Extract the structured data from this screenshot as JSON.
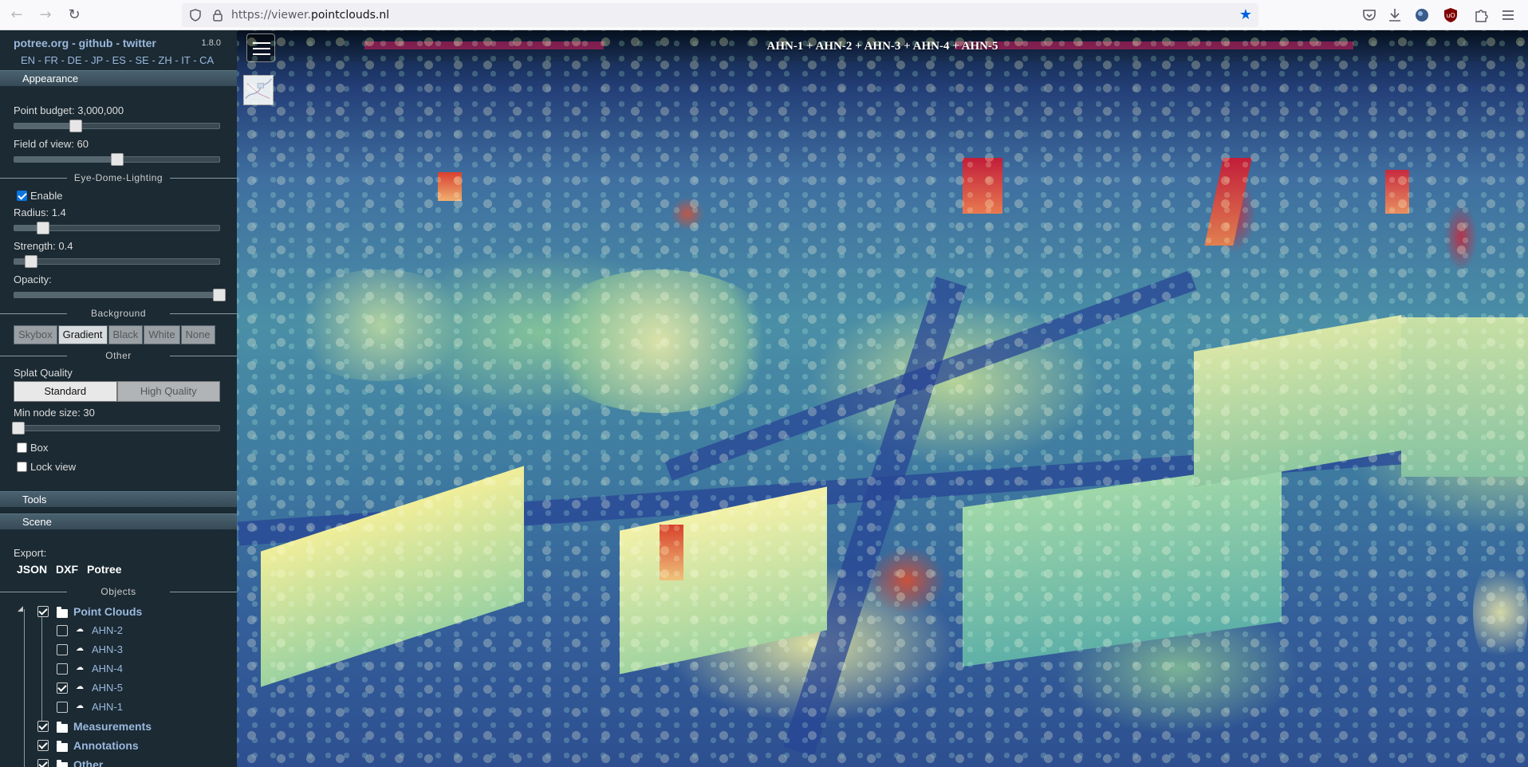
{
  "browser": {
    "url_prefix": "https://viewer.",
    "url_host": "pointclouds.nl"
  },
  "sidebar": {
    "brand": "potree.org - github - twitter",
    "version": "1.8.0",
    "languages": "EN - FR - DE - JP - ES - SE - ZH - IT - CA",
    "appearance": {
      "header": "Appearance",
      "point_budget_label": "Point budget: 3,000,000",
      "point_budget_fraction": 0.3,
      "fov_label": "Field of view: 60",
      "fov_fraction": 0.5,
      "edl_title": "Eye-Dome-Lighting",
      "edl_enable_label": "Enable",
      "edl_enabled": true,
      "radius_label": "Radius: 1.4",
      "radius_fraction": 0.14,
      "strength_label": "Strength: 0.4",
      "strength_fraction": 0.08,
      "opacity_label": "Opacity:",
      "opacity_fraction": 1.0,
      "background_title": "Background",
      "background_options": [
        "Skybox",
        "Gradient",
        "Black",
        "White",
        "None"
      ],
      "background_selected": "Gradient",
      "other_title": "Other",
      "splat_quality_label": "Splat Quality",
      "splat_options": [
        "Standard",
        "High Quality"
      ],
      "splat_selected": "Standard",
      "min_node_label": "Min node size: 30",
      "min_node_fraction": 0.02,
      "box_label": "Box",
      "lock_view_label": "Lock view"
    },
    "tools_header": "Tools",
    "scene_header": "Scene",
    "export_label": "Export:",
    "export_links": [
      "JSON",
      "DXF",
      "Potree"
    ],
    "objects_title": "Objects",
    "tree": {
      "point_clouds": "Point Clouds",
      "clouds": [
        {
          "name": "AHN-2",
          "checked": false
        },
        {
          "name": "AHN-3",
          "checked": false
        },
        {
          "name": "AHN-4",
          "checked": false
        },
        {
          "name": "AHN-5",
          "checked": true
        },
        {
          "name": "AHN-1",
          "checked": false
        }
      ],
      "measurements": "Measurements",
      "annotations": "Annotations",
      "other": "Other"
    }
  },
  "viewport": {
    "title": "AHN-1 + AHN-2 + AHN-3 + AHN-4 + AHN-5"
  },
  "colors": {
    "sidebar_bg": "#1b2a33",
    "link": "#9bb8dd",
    "checkbox_blue": "#0b74de",
    "bookmark_star": "#0061e0"
  }
}
